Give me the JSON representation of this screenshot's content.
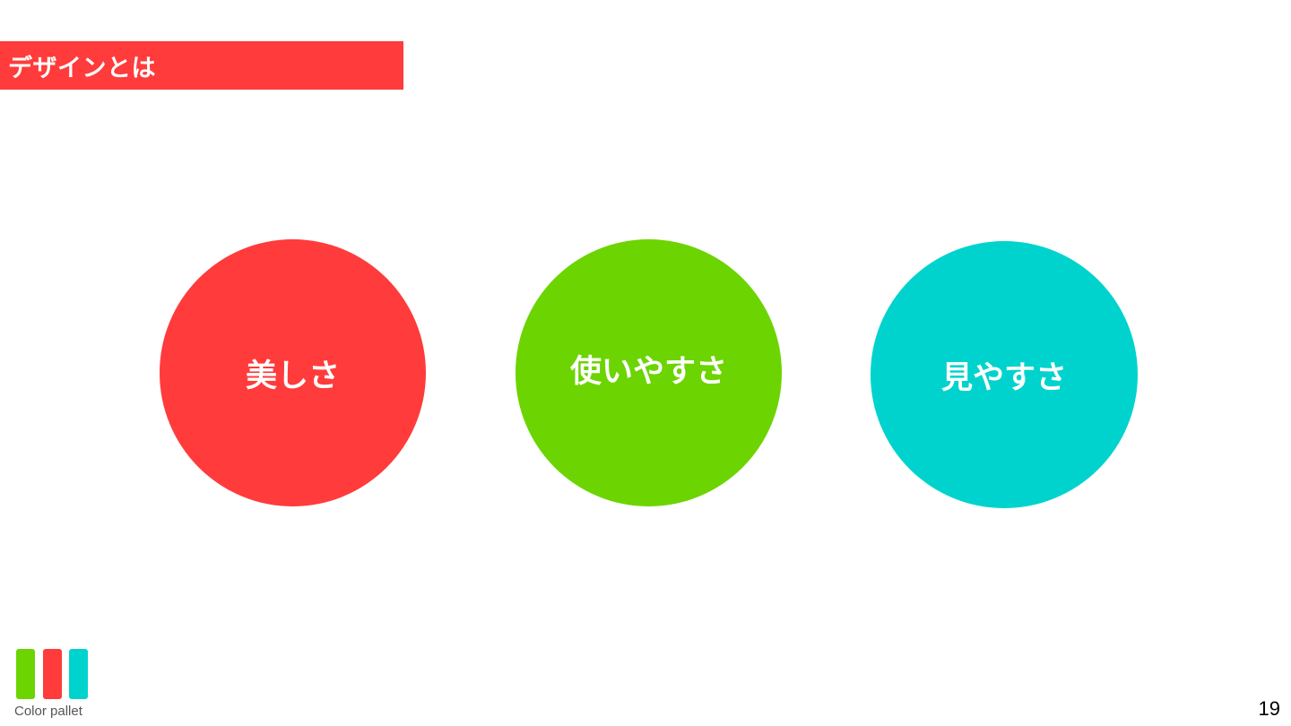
{
  "slide": {
    "title": "デザインとは",
    "circles": [
      {
        "label": "美しさ",
        "color": "#ff3b3b"
      },
      {
        "label": "使いやすさ",
        "color": "#6cd400"
      },
      {
        "label": "見やすさ",
        "color": "#00d3cd"
      }
    ],
    "palette": {
      "label": "Color pallet",
      "swatches": [
        "#6cd400",
        "#ff3b3b",
        "#00d3cd"
      ]
    },
    "page_number": "19"
  },
  "colors": {
    "accent_red": "#ff3b3b",
    "accent_green": "#6cd400",
    "accent_cyan": "#00d3cd",
    "background": "#ffffff"
  }
}
